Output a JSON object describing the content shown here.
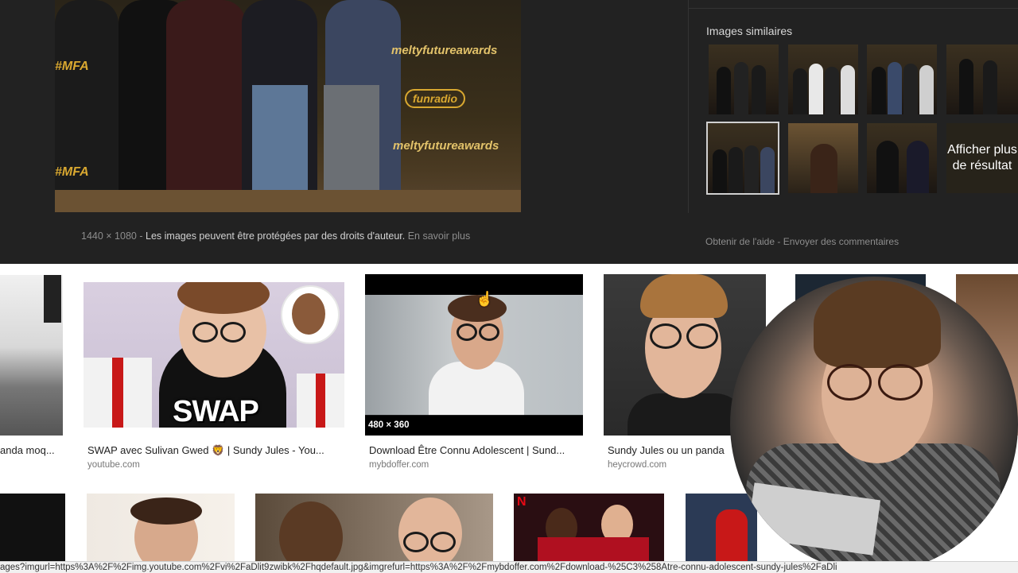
{
  "preview": {
    "image_dims": "1440 × 1080",
    "copyright_notice": "Les images peuvent être protégées par des droits d'auteur.",
    "learn_more": "En savoir plus",
    "separator": "-",
    "brand_texts": [
      "#MFA",
      "#MFA",
      "meltyfutureawards",
      "meltyfutureawards",
      "funradio"
    ]
  },
  "similar": {
    "title": "Images similaires",
    "more_label": "Afficher plus de résultat",
    "help_link": "Obtenir de l'aide",
    "feedback_link": "Envoyer des commentaires",
    "separator": "-"
  },
  "results": [
    {
      "caption": "anda moq...",
      "domain": ""
    },
    {
      "caption": "SWAP avec Sulivan Gwed 🦁 | Sundy Jules - You...",
      "domain": "youtube.com",
      "overlay": "SWAP"
    },
    {
      "caption": "Download Être Connu Adolescent | Sund...",
      "domain": "mybdoffer.com",
      "badge": "480 × 360"
    },
    {
      "caption": "Sundy Jules ou un panda",
      "domain": "heycrowd.com"
    }
  ],
  "statusbar": {
    "url": "ages?imgurl=https%3A%2F%2Fimg.youtube.com%2Fvi%2FaDlit9zwibk%2Fhqdefault.jpg&imgrefurl=https%3A%2F%2Fmybdoffer.com%2Fdownload-%25C3%258Atre-connu-adolescent-sundy-jules%2FaDli"
  },
  "colors": {
    "panel_bg": "#222222",
    "accent_gold": "#d9a830",
    "link_gray": "#8d8d8d"
  }
}
